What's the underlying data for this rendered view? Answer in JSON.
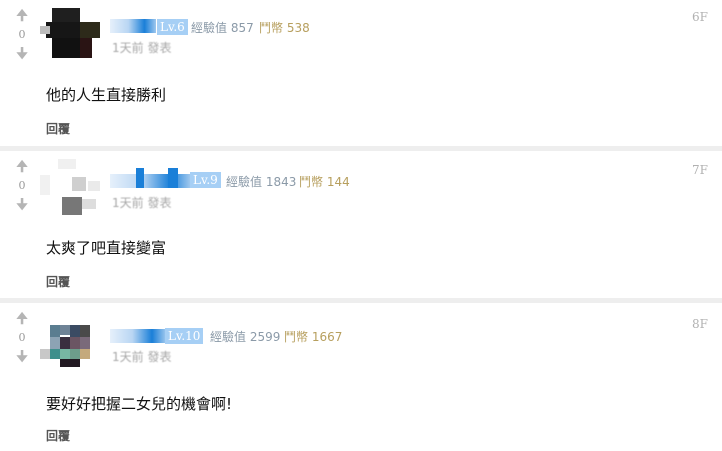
{
  "comments": [
    {
      "vote_count": "0",
      "level": "Lv.6",
      "exp_label": "經驗值 857",
      "coin_label": "鬥幣 538",
      "time_label": "1天前 發表",
      "floor": "6F",
      "text": "他的人生直接勝利",
      "reply_label": "回覆"
    },
    {
      "vote_count": "0",
      "level": "Lv.9",
      "exp_label": "經驗值 1843",
      "coin_label": "鬥幣 144",
      "time_label": "1天前 發表",
      "floor": "7F",
      "text": "太爽了吧直接變富",
      "reply_label": "回覆"
    },
    {
      "vote_count": "0",
      "level": "Lv.10",
      "exp_label": "經驗值 2599",
      "coin_label": "鬥幣 1667",
      "time_label": "1天前 發表",
      "floor": "8F",
      "text": "要好好把握二女兒的機會啊!",
      "reply_label": "回覆"
    }
  ],
  "icons": {
    "upvote": "up-arrow-icon",
    "downvote": "down-arrow-icon"
  },
  "colors": {
    "level_badge": "#a6cff5",
    "exp_text": "#8b9aa8",
    "coin_text": "#b79f5e",
    "separator": "#eeeeee"
  }
}
